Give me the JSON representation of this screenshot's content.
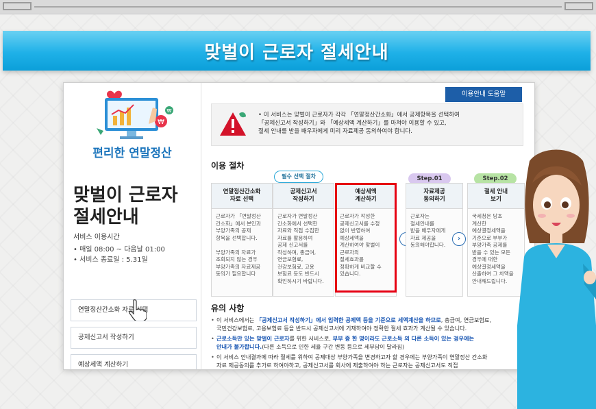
{
  "banner": {
    "title": "맞벌이 근로자 절세안내"
  },
  "left": {
    "brand": "편리한 연말정산",
    "service_title": "맞벌이 근로자\n절세안내",
    "hours_label": "서비스 이용시간",
    "hours": [
      "• 매일 08:00 ~ 다음날 01:00",
      "• 서비스 종료일 : 5.31일"
    ],
    "buttons": [
      "연말정산간소화 자료 선택",
      "공제신고서 작성하기",
      "예상세액 계산하기"
    ]
  },
  "help_button": "이용안내 도움말",
  "notice": {
    "lines": [
      "• 이 서비스는 맞벌이 근로자가 각각 「연말정산간소화」에서 공제항목을 선택하여",
      "「공제신고서 작성하기」와 「예상세액 계산하기」를 마쳐야 이용할 수 있고,",
      "절세 안내를 받을 배우자에게 미리 자료제공 동의하여야 합니다."
    ]
  },
  "procedure": {
    "title": "이용 절차",
    "required_label": "필수 선택 절차",
    "steps": [
      {
        "head": "연말정산간소화\n자료 선택",
        "body": "근로자가 「연말정산\n간소화」에서 본인과\n부양가족의 공제\n항목을 선택합니다.\n\n부양가족의 자료가\n조회되지 않는 경우\n부양가족의 자료제공\n동의가 필요합니다"
      },
      {
        "head": "공제신고서\n작성하기",
        "body": "근로자가 연말정산\n간소화에서 선택한\n자료와 직접 수집한\n자료를 활용하여\n공제 신고서를\n작성하며, 총급여,\n연금보험료,\n건강보험료, 고용\n보험료 등도 반드시\n확인하시기 바랍니다."
      },
      {
        "head": "예상세액\n계산하기",
        "body": "근로자가 작성한\n공제신고서를 수정\n없이 반영하여\n예상세액을\n계산하여야 맞벌이\n근로자의\n절세효과를\n정확하게 비교할 수\n있습니다."
      },
      {
        "head": "자료제공\n동의하기",
        "body": "근로자는\n절세안내를\n받을 배우자에게\n자료 제공을\n동의해야합니다."
      },
      {
        "head": "절세 안내\n보기",
        "body": "국세청은 당초\n계산한\n예상결정세액을\n기준으로 부부가\n부양가족 공제를\n받을 수 있는 모든\n경우에 대한\n예상결정세액을\n산출하여 그 차액을\n안내해드립니다."
      }
    ],
    "step_badges": [
      "Step.01",
      "Step.02"
    ]
  },
  "caution": {
    "title": "유의 사항",
    "items": [
      [
        {
          "t": "이 서비스에서는 "
        },
        {
          "t": "「공제신고서 작성하기」에서 입력한 공제액 등을 기준으로 세액계산을 하므로",
          "blue": true
        },
        {
          "t": ", 총급여, 연금보험료,"
        },
        {
          "t": "|"
        },
        {
          "t": "국민건강보험료, 고용보험료 등을 반드시 공제신고서에 기재하여야 정확한 절세 효과가 계산될 수 있습니다."
        }
      ],
      [
        {
          "t": "근로소득만 있는 맞벌이 근로자",
          "blue": true
        },
        {
          "t": "를 위한 서비스로, "
        },
        {
          "t": "부부 중 한 명이라도 근로소득 외 다른 소득이 있는 경우에는",
          "blue": true
        },
        {
          "t": "|"
        },
        {
          "t": "안내가 불가합니다.",
          "blue": true
        },
        {
          "t": "(다른 소득으로 인한 세율 구간 변동 등으로 세부담이 달라짐)"
        }
      ],
      [
        {
          "t": "이 서비스 안내결과에 따라 절세를 위하여 공제대상 부양가족을 변경하고자 할 경우에는 부양가족이 연말정산 간소화"
        },
        {
          "t": "|"
        },
        {
          "t": "자료 제공동의를 추가로 하여야하고, 공제신고서를 회사에 제출하여야 하는 근로자는 공제신고서도 직접"
        }
      ]
    ]
  },
  "colors": {
    "banner": "#1fb1e8",
    "brand_text": "#1c75bc",
    "help_button": "#1d5ea8",
    "highlight": "#e60012",
    "step1": "#d9c8ef",
    "step2": "#b7e3a4"
  }
}
